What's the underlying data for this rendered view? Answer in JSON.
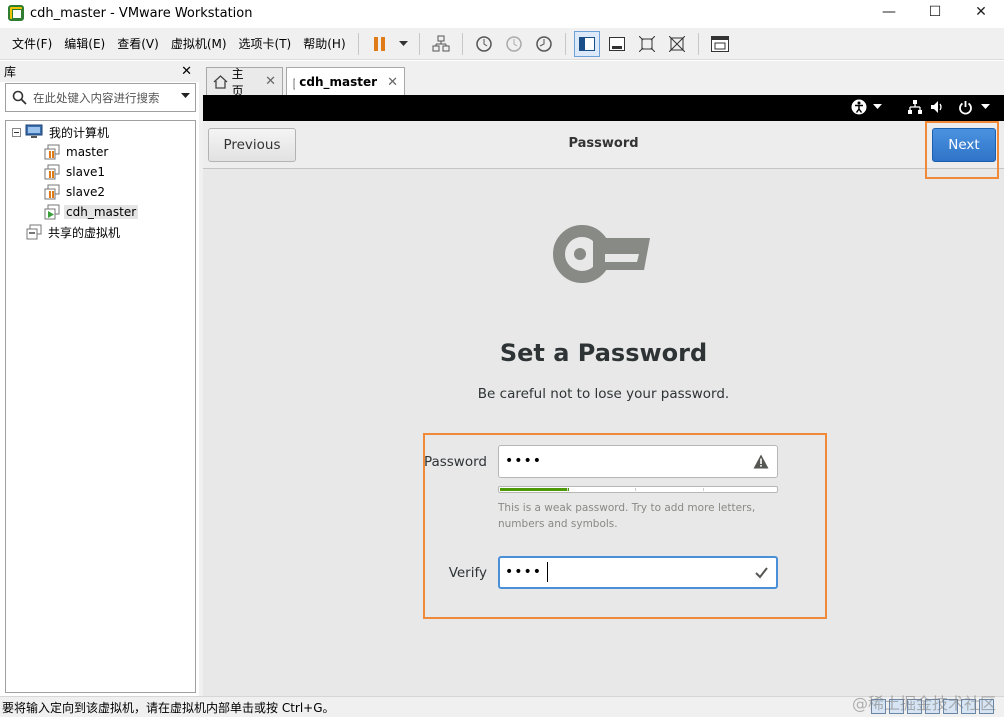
{
  "window": {
    "title": "cdh_master - VMware Workstation",
    "minimize": "—",
    "maximize": "☐",
    "close": "✕"
  },
  "menu": [
    "文件(F)",
    "编辑(E)",
    "查看(V)",
    "虚拟机(M)",
    "选项卡(T)",
    "帮助(H)"
  ],
  "library": {
    "title": "库",
    "close": "✕",
    "search_placeholder": "在此处键入内容进行搜索",
    "root": "我的计算机",
    "vms": [
      "master",
      "slave1",
      "slave2",
      "cdh_master"
    ],
    "selected_vm": "cdh_master",
    "shared": "共享的虚拟机"
  },
  "tabs": [
    {
      "label": "主页",
      "close": "✕"
    },
    {
      "label": "cdh_master",
      "close": "✕"
    }
  ],
  "setup": {
    "previous_label": "Previous",
    "header_title": "Password",
    "next_label": "Next",
    "heading": "Set a Password",
    "subheading": "Be careful not to lose your password.",
    "password_label": "Password",
    "password_value": "abcd",
    "strength_level": 0.25,
    "hint": "This is a weak password. Try to add more letters, numbers and symbols.",
    "verify_label": "Verify",
    "verify_value": "abcd"
  },
  "status": {
    "text": "要将输入定向到该虚拟机，请在虚拟机内部单击或按 Ctrl+G。",
    "watermark": "@稀土掘金技术社区"
  },
  "colors": {
    "accent": "#2f74c8",
    "highlight": "#ef8a3a",
    "strength": "#4e9a06",
    "gnome_topbar": "#000000"
  }
}
